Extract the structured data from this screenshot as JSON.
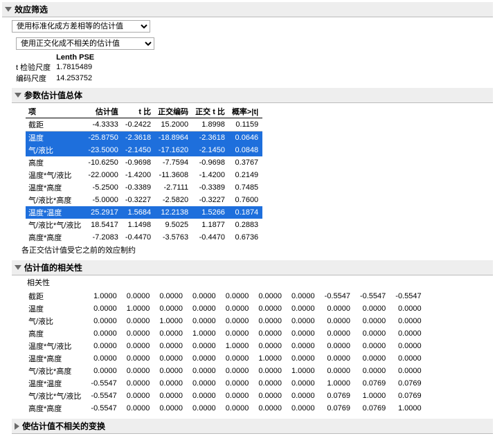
{
  "sections": {
    "effect_screen": "效应筛选",
    "param_total": "参数估计值总体",
    "corr": "估计值的相关性",
    "trans": "使估计值不相关的变换"
  },
  "dropdowns": {
    "std": "使用标准化成方差相等的估计值",
    "orth": "使用正交化成不相关的估计值"
  },
  "pse_header": "Lenth PSE",
  "kv": [
    {
      "label": "t 检验尺度",
      "value": "1.7815489"
    },
    {
      "label": "编码尺度",
      "value": "14.253752"
    }
  ],
  "est_headers": [
    "项",
    "估计值",
    "t 比",
    "正交编码",
    "正交 t 比",
    "概率>|t|"
  ],
  "est_rows": [
    {
      "c": [
        "截距",
        "-4.3333",
        "-0.2422",
        "15.2000",
        "1.8998",
        "0.1159"
      ],
      "hl": false,
      "line": true
    },
    {
      "c": [
        "温度",
        "-25.8750",
        "-2.3618",
        "-18.8964",
        "-2.3618",
        "0.0646"
      ],
      "hl": true,
      "line": false
    },
    {
      "c": [
        "气/液比",
        "-23.5000",
        "-2.1450",
        "-17.1620",
        "-2.1450",
        "0.0848"
      ],
      "hl": true,
      "line": false
    },
    {
      "c": [
        "高度",
        "-10.6250",
        "-0.9698",
        "-7.7594",
        "-0.9698",
        "0.3767"
      ],
      "hl": false,
      "line": false
    },
    {
      "c": [
        "温度*气/液比",
        "-22.0000",
        "-1.4200",
        "-11.3608",
        "-1.4200",
        "0.2149"
      ],
      "hl": false,
      "line": false
    },
    {
      "c": [
        "温度*高度",
        "-5.2500",
        "-0.3389",
        "-2.7111",
        "-0.3389",
        "0.7485"
      ],
      "hl": false,
      "line": false
    },
    {
      "c": [
        "气/液比*高度",
        "-5.0000",
        "-0.3227",
        "-2.5820",
        "-0.3227",
        "0.7600"
      ],
      "hl": false,
      "line": false
    },
    {
      "c": [
        "温度*温度",
        "25.2917",
        "1.5684",
        "12.2138",
        "1.5266",
        "0.1874"
      ],
      "hl": true,
      "line": false
    },
    {
      "c": [
        "气/液比*气/液比",
        "18.5417",
        "1.1498",
        "9.5025",
        "1.1877",
        "0.2883"
      ],
      "hl": false,
      "line": false
    },
    {
      "c": [
        "高度*高度",
        "-7.2083",
        "-0.4470",
        "-3.5763",
        "-0.4470",
        "0.6736"
      ],
      "hl": false,
      "line": false
    }
  ],
  "est_footnote": "各正交估计值受它之前的效应制约",
  "corr_title": "相关性",
  "corr_row_labels": [
    "截距",
    "温度",
    "气/液比",
    "高度",
    "温度*气/液比",
    "温度*高度",
    "气/液比*高度",
    "温度*温度",
    "气/液比*气/液比",
    "高度*高度"
  ],
  "corr_matrix": [
    [
      "1.0000",
      "0.0000",
      "0.0000",
      "0.0000",
      "0.0000",
      "0.0000",
      "0.0000",
      "-0.5547",
      "-0.5547",
      "-0.5547"
    ],
    [
      "0.0000",
      "1.0000",
      "0.0000",
      "0.0000",
      "0.0000",
      "0.0000",
      "0.0000",
      "0.0000",
      "0.0000",
      "0.0000"
    ],
    [
      "0.0000",
      "0.0000",
      "1.0000",
      "0.0000",
      "0.0000",
      "0.0000",
      "0.0000",
      "0.0000",
      "0.0000",
      "0.0000"
    ],
    [
      "0.0000",
      "0.0000",
      "0.0000",
      "1.0000",
      "0.0000",
      "0.0000",
      "0.0000",
      "0.0000",
      "0.0000",
      "0.0000"
    ],
    [
      "0.0000",
      "0.0000",
      "0.0000",
      "0.0000",
      "1.0000",
      "0.0000",
      "0.0000",
      "0.0000",
      "0.0000",
      "0.0000"
    ],
    [
      "0.0000",
      "0.0000",
      "0.0000",
      "0.0000",
      "0.0000",
      "1.0000",
      "0.0000",
      "0.0000",
      "0.0000",
      "0.0000"
    ],
    [
      "0.0000",
      "0.0000",
      "0.0000",
      "0.0000",
      "0.0000",
      "0.0000",
      "1.0000",
      "0.0000",
      "0.0000",
      "0.0000"
    ],
    [
      "-0.5547",
      "0.0000",
      "0.0000",
      "0.0000",
      "0.0000",
      "0.0000",
      "0.0000",
      "1.0000",
      "0.0769",
      "0.0769"
    ],
    [
      "-0.5547",
      "0.0000",
      "0.0000",
      "0.0000",
      "0.0000",
      "0.0000",
      "0.0000",
      "0.0769",
      "1.0000",
      "0.0769"
    ],
    [
      "-0.5547",
      "0.0000",
      "0.0000",
      "0.0000",
      "0.0000",
      "0.0000",
      "0.0000",
      "0.0769",
      "0.0769",
      "1.0000"
    ]
  ]
}
